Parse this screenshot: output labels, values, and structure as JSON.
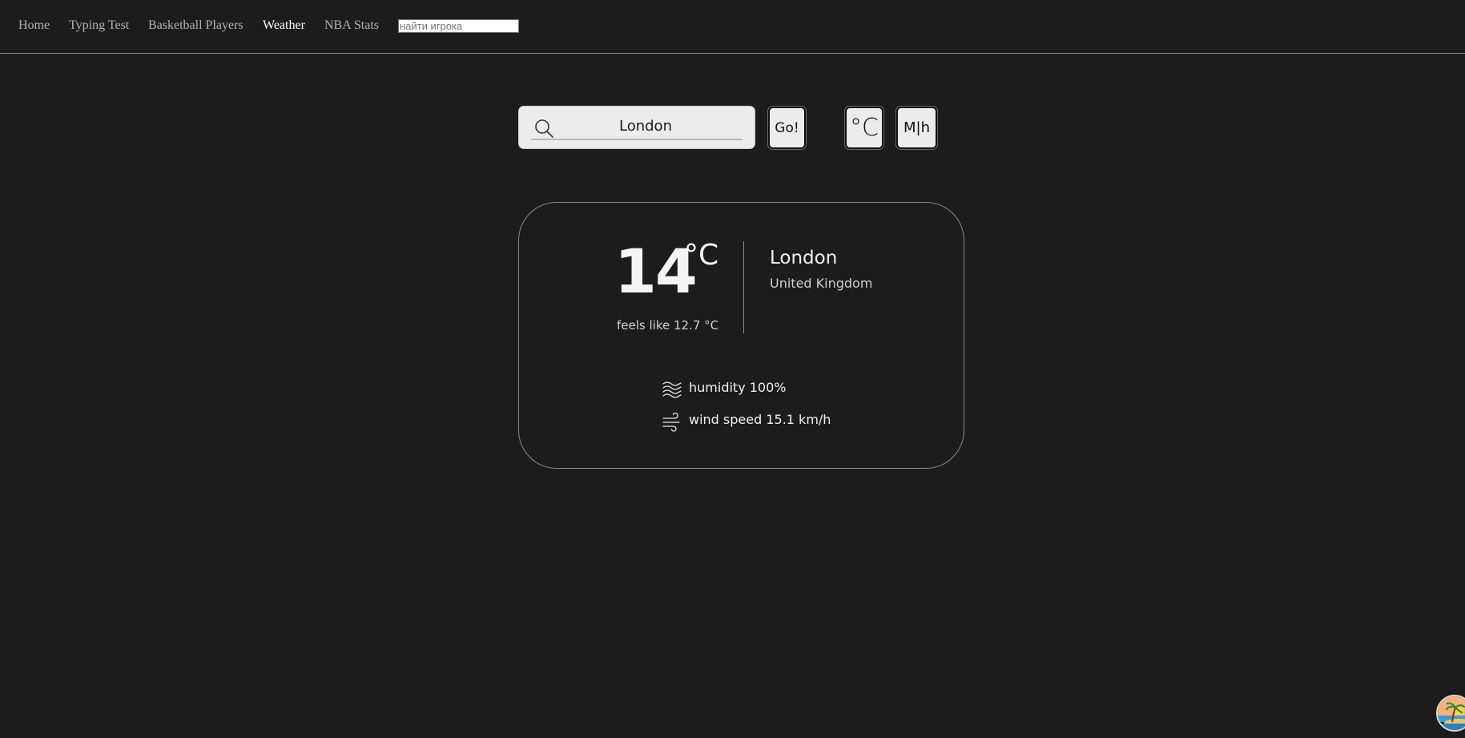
{
  "nav": {
    "links": [
      {
        "label": "Home"
      },
      {
        "label": "Typing Test"
      },
      {
        "label": "Basketball Players"
      },
      {
        "label": "Weather",
        "active": true
      },
      {
        "label": "NBA Stats"
      }
    ],
    "search_placeholder": "найти игрока"
  },
  "search": {
    "value": "London",
    "go_label": "Go!",
    "unit_label": "°C",
    "speed_label": "M|h"
  },
  "weather": {
    "temperature": "14",
    "unit": "°C",
    "feels_like": "feels like 12.7 °C",
    "city": "London",
    "country": "United Kingdom",
    "humidity": "humidity 100%",
    "wind": "wind speed 15.1 km/h"
  },
  "colors": {
    "background": "#1c1c1c",
    "text": "#f0f0f0",
    "muted": "#b3b3b3",
    "border": "#8a8a8a",
    "button_bg": "#ececec"
  },
  "icons": {
    "search": "search-icon",
    "humidity": "humidity-icon",
    "wind": "wind-icon",
    "avatar": "extension-avatar-icon"
  }
}
